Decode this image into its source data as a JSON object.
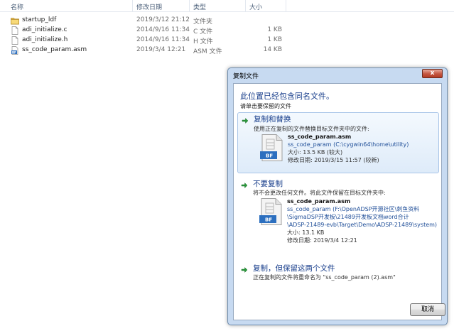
{
  "explorer": {
    "columns": {
      "name": "名称",
      "date": "修改日期",
      "type": "类型",
      "size": "大小"
    },
    "files": [
      {
        "name": "startup_ldf",
        "date": "2019/3/12 21:12",
        "type": "文件夹",
        "size": "",
        "icon": "folder-icon"
      },
      {
        "name": "adi_initialize.c",
        "date": "2014/9/16 11:34",
        "type": "C 文件",
        "size": "1 KB",
        "icon": "file-icon"
      },
      {
        "name": "adi_initialize.h",
        "date": "2014/9/16 11:34",
        "type": "H 文件",
        "size": "1 KB",
        "icon": "file-icon"
      },
      {
        "name": "ss_code_param.asm",
        "date": "2019/3/4 12:21",
        "type": "ASM 文件",
        "size": "14 KB",
        "icon": "asm-file-icon"
      }
    ]
  },
  "dialog": {
    "title": "复制文件",
    "close": "x",
    "heading": "此位置已经包含同名文件。",
    "subheading": "请单击要保留的文件",
    "replace": {
      "title": "复制和替换",
      "desc": "使用正在复制的文件替换目标文件夹中的文件:",
      "file_name": "ss_code_param.asm",
      "path": "ss_code_param (C:\\cygwin64\\home\\utility)",
      "size": "大小: 13.5 KB (较大)",
      "modified": "修改日期: 2019/3/15 11:57 (较新)",
      "badge": "BF"
    },
    "skip": {
      "title": "不要复制",
      "desc": "将不会更改任何文件。将此文件保留在目标文件夹中:",
      "file_name": "ss_code_param.asm",
      "path_line1": "ss_code_param (F:\\OpenADSP开源社区\\刺鱼资料",
      "path_line2": "\\SigmaDSP开发板\\21489开发板文档word合计",
      "path_line3": "\\ADSP-21489-evb\\Target\\Demo\\ADSP-21489\\system)",
      "size": "大小: 13.1 KB",
      "modified": "修改日期: 2019/3/4 12:21",
      "badge": "BF"
    },
    "keep_both": {
      "title": "复制，但保留这两个文件",
      "desc": "正在复制的文件将重命名为 \"ss_code_param (2).asm\""
    },
    "cancel": "取消"
  }
}
